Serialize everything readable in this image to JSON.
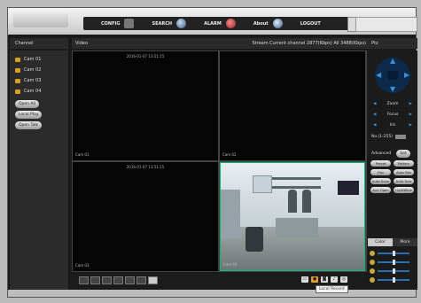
{
  "header": {
    "nav": [
      {
        "label": "CONFIG",
        "icon": "config-icon"
      },
      {
        "label": "SEARCH",
        "icon": "search-icon"
      },
      {
        "label": "ALARM",
        "icon": "alarm-icon"
      },
      {
        "label": "About",
        "icon": "about-icon"
      },
      {
        "label": "LOGOUT",
        "icon": "logout-icon"
      }
    ]
  },
  "panels": {
    "channel": "Channel",
    "video": "Video",
    "rate": "Stream Current channel 2877(Kbps) All 3488(Kbps)",
    "ptz": "Ptz"
  },
  "channels": [
    "Cam 01",
    "Cam 02",
    "Cam 03",
    "Cam 04"
  ],
  "channel_buttons": [
    "Open All",
    "Local Play",
    "Open Talk"
  ],
  "tiles": [
    {
      "label": "Cam 01",
      "timestamp": "2016-01-07 13:51:15"
    },
    {
      "label": "Cam 02",
      "timestamp": ""
    },
    {
      "label": "Cam 03",
      "timestamp": "2016-01-07 13:51:15"
    },
    {
      "label": "Cam 04",
      "timestamp": ""
    }
  ],
  "tooltip": "Local Record",
  "ptz": {
    "zoom": "Zoom",
    "focus": "Focus",
    "iris": "Iris",
    "no_label": "No.(1-255)",
    "advanced": "Advanced",
    "set": "Set",
    "buttons": [
      "Preset",
      "Pattern",
      "Flip",
      "Auto Pan",
      "Auto Scan",
      "Auto Tour",
      "Aux Open",
      "LightWipe"
    ],
    "tabs": [
      "Color",
      "More"
    ]
  }
}
